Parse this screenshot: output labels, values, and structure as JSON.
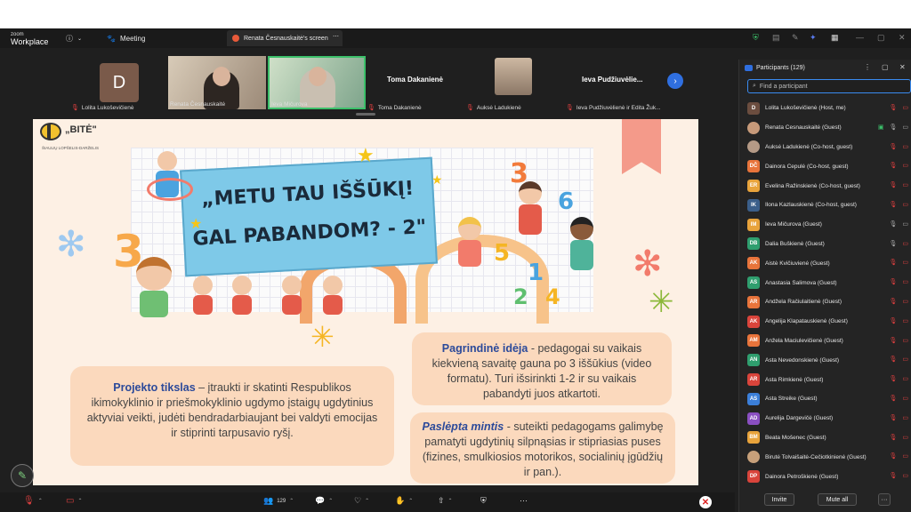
{
  "titlebar": {
    "app_top": "zoom",
    "app_name": "Workplace",
    "meeting_label": "Meeting",
    "tab_label": "Renata Česnauskaitė's screen"
  },
  "gallery": {
    "tiles": [
      {
        "name": "Lolita Lukoševičienė",
        "initial": "D"
      },
      {
        "name": "Renata Česnauskaitė"
      },
      {
        "name": "Ieva Mičurova"
      },
      {
        "name": "Toma Dakanienė",
        "display": "Toma Dakanienė"
      },
      {
        "name": "Auksė Ladukienė"
      },
      {
        "name": "Ieva Pudžiuvėlienė ir Edita Žuk...",
        "display": "Ieva  Pudžiuvėlie..."
      }
    ]
  },
  "slide": {
    "brand_title": "„BITĖ\"",
    "brand_sub": "ŠIAULIŲ LOPŠELIS-DARŽELIS",
    "banner_line1": "„METU TAU IŠŠŪKĮ!",
    "banner_line2": "GAL PABANDOM? - 2\"",
    "card1_bold": "Projekto tikslas",
    "card1_text": " – įtraukti ir skatinti Respublikos ikimokyklinio ir priešmokyklinio ugdymo įstaigų ugdytinius aktyviai veikti, judėti bendradarbiaujant bei valdyti emocijas ir stiprinti tarpusavio ryšį.",
    "card2_bold": "Pagrindinė idėja",
    "card2_text": " - pedagogai su vaikais kiekvieną savaitę gauna po 3 iššūkius (video formatu). Turi išsirinkti 1-2 ir su vaikais pabandyti juos atkartoti.",
    "card3_bold": "Paslėpta mintis",
    "card3_text": " - suteikti pedagogams galimybę pamatyti ugdytinių silpnąsias ir stipriasias puses (fizines, smulkiosios motorikos, socialinių įgūdžių ir pan.).",
    "numbers": [
      "3",
      "5",
      "1",
      "6",
      "2",
      "4"
    ]
  },
  "toolbar": {
    "participant_count": "129"
  },
  "panel": {
    "title": "Participants (129)",
    "search_placeholder": "Find a participant",
    "invite_label": "Invite",
    "mute_all_label": "Mute all",
    "more_label": "···",
    "participants": [
      {
        "name": "Lolita Lukoševičienė (Host, me)",
        "initials": "D",
        "color": "#6b4d3f",
        "mic": "off",
        "video": "off"
      },
      {
        "name": "Renata Česnauskaitė (Guest)",
        "initials": "",
        "color": "#c79a7a",
        "mic": "on",
        "video": "on",
        "sharing": true
      },
      {
        "name": "Auksė Ladukienė (Co-host, guest)",
        "initials": "",
        "color": "#b59a86",
        "mic": "off",
        "video": "off"
      },
      {
        "name": "Dainora Čepulė (Co-host, guest)",
        "initials": "DČ",
        "color": "#e8743b",
        "mic": "off",
        "video": "off"
      },
      {
        "name": "Evelina Ražinskienė (Co-host, guest)",
        "initials": "ER",
        "color": "#e8a33b",
        "mic": "off",
        "video": "off"
      },
      {
        "name": "Ilona Kazlauskienė (Co-host, guest)",
        "initials": "IK",
        "color": "#3b5f8a",
        "mic": "off",
        "video": "off"
      },
      {
        "name": "Ieva Mičurova (Guest)",
        "initials": "IM",
        "color": "#e8a33b",
        "mic": "on",
        "video": "on"
      },
      {
        "name": "Dalia Buškienė (Guest)",
        "initials": "DB",
        "color": "#2f9e6e",
        "mic": "on",
        "video": "off"
      },
      {
        "name": "Aistė Kvičiuvienė (Guest)",
        "initials": "AK",
        "color": "#e8743b",
        "mic": "off",
        "video": "off"
      },
      {
        "name": "Anastasia Salimova (Guest)",
        "initials": "AS",
        "color": "#2f9e6e",
        "mic": "off",
        "video": "off"
      },
      {
        "name": "Andželа Račiulaitienė (Guest)",
        "initials": "AR",
        "color": "#e8743b",
        "mic": "off",
        "video": "off"
      },
      {
        "name": "Angelija Klapatauskienė (Guest)",
        "initials": "AK",
        "color": "#d9443b",
        "mic": "off",
        "video": "off"
      },
      {
        "name": "Anžela Maciulevičienė (Guest)",
        "initials": "AM",
        "color": "#e8743b",
        "mic": "off",
        "video": "off"
      },
      {
        "name": "Asta Nevedonskienė (Guest)",
        "initials": "AN",
        "color": "#2f9e6e",
        "mic": "off",
        "video": "off"
      },
      {
        "name": "Asta Rimkienė (Guest)",
        "initials": "AR",
        "color": "#d9443b",
        "mic": "off",
        "video": "off"
      },
      {
        "name": "Asta Streike (Guest)",
        "initials": "AS",
        "color": "#3b7fd9",
        "mic": "off",
        "video": "off"
      },
      {
        "name": "Aurelija Dargevičė (Guest)",
        "initials": "AD",
        "color": "#8a4fc1",
        "mic": "off",
        "video": "off"
      },
      {
        "name": "Beata Mošenec (Guest)",
        "initials": "BM",
        "color": "#e8a33b",
        "mic": "off",
        "video": "off"
      },
      {
        "name": "Birutė Tolvaišaitė-Čečiotkinienė (Guest)",
        "initials": "",
        "color": "#c7a07a",
        "mic": "off",
        "video": "off"
      },
      {
        "name": "Dainora Petroškienė (Guest)",
        "initials": "DP",
        "color": "#d9443b",
        "mic": "off",
        "video": "off"
      }
    ]
  }
}
